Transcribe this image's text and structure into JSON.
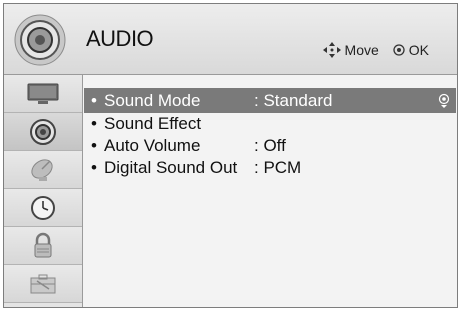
{
  "header": {
    "title": "AUDIO",
    "hint_move": "Move",
    "hint_ok": "OK",
    "icon": "speaker-icon"
  },
  "sidebar": {
    "items": [
      {
        "name": "picture-icon",
        "active": false
      },
      {
        "name": "audio-icon",
        "active": true
      },
      {
        "name": "channel-satellite-icon",
        "active": false
      },
      {
        "name": "time-clock-icon",
        "active": false
      },
      {
        "name": "lock-icon",
        "active": false
      },
      {
        "name": "option-toolbox-icon",
        "active": false
      }
    ]
  },
  "menu": {
    "bullet": "•",
    "items": [
      {
        "label": "Sound Mode",
        "value": ": Standard",
        "selected": true
      },
      {
        "label": "Sound Effect",
        "value": "",
        "selected": false
      },
      {
        "label": "Auto Volume",
        "value": ": Off",
        "selected": false
      },
      {
        "label": "Digital Sound Out",
        "value": ": PCM",
        "selected": false
      }
    ]
  },
  "colors": {
    "selected_row": "#7a7a7a",
    "background": "#f3f3f3"
  }
}
